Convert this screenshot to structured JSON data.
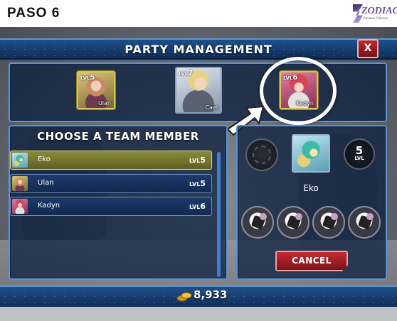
{
  "step_label": "PASO 6",
  "logo": {
    "main": "ZODIAC",
    "sub": "Orcanon Odyssey"
  },
  "header": {
    "title": "PARTY MANAGEMENT",
    "close_label": "X"
  },
  "party": [
    {
      "name": "Ulan",
      "lvl_prefix": "LVL",
      "level": "5"
    },
    {
      "name": "Cael",
      "lvl_prefix": "LVL",
      "level": "7"
    },
    {
      "name": "Kadyn",
      "lvl_prefix": "LVL",
      "level": "6"
    }
  ],
  "choose_panel": {
    "title": "CHOOSE A TEAM MEMBER",
    "members": [
      {
        "name": "Eko",
        "lvl_prefix": "LVL",
        "level": "5",
        "selected": true
      },
      {
        "name": "Ulan",
        "lvl_prefix": "LVL",
        "level": "5",
        "selected": false
      },
      {
        "name": "Kadyn",
        "lvl_prefix": "LVL",
        "level": "6",
        "selected": false
      }
    ]
  },
  "detail": {
    "name": "Eko",
    "level": "5",
    "level_unit": "LVL",
    "cancel_label": "CANCEL"
  },
  "currency": {
    "gold": "8,933"
  },
  "colors": {
    "accent": "#5d93cf",
    "selected_row": "#8a8a3c",
    "cancel": "#c12d33"
  }
}
